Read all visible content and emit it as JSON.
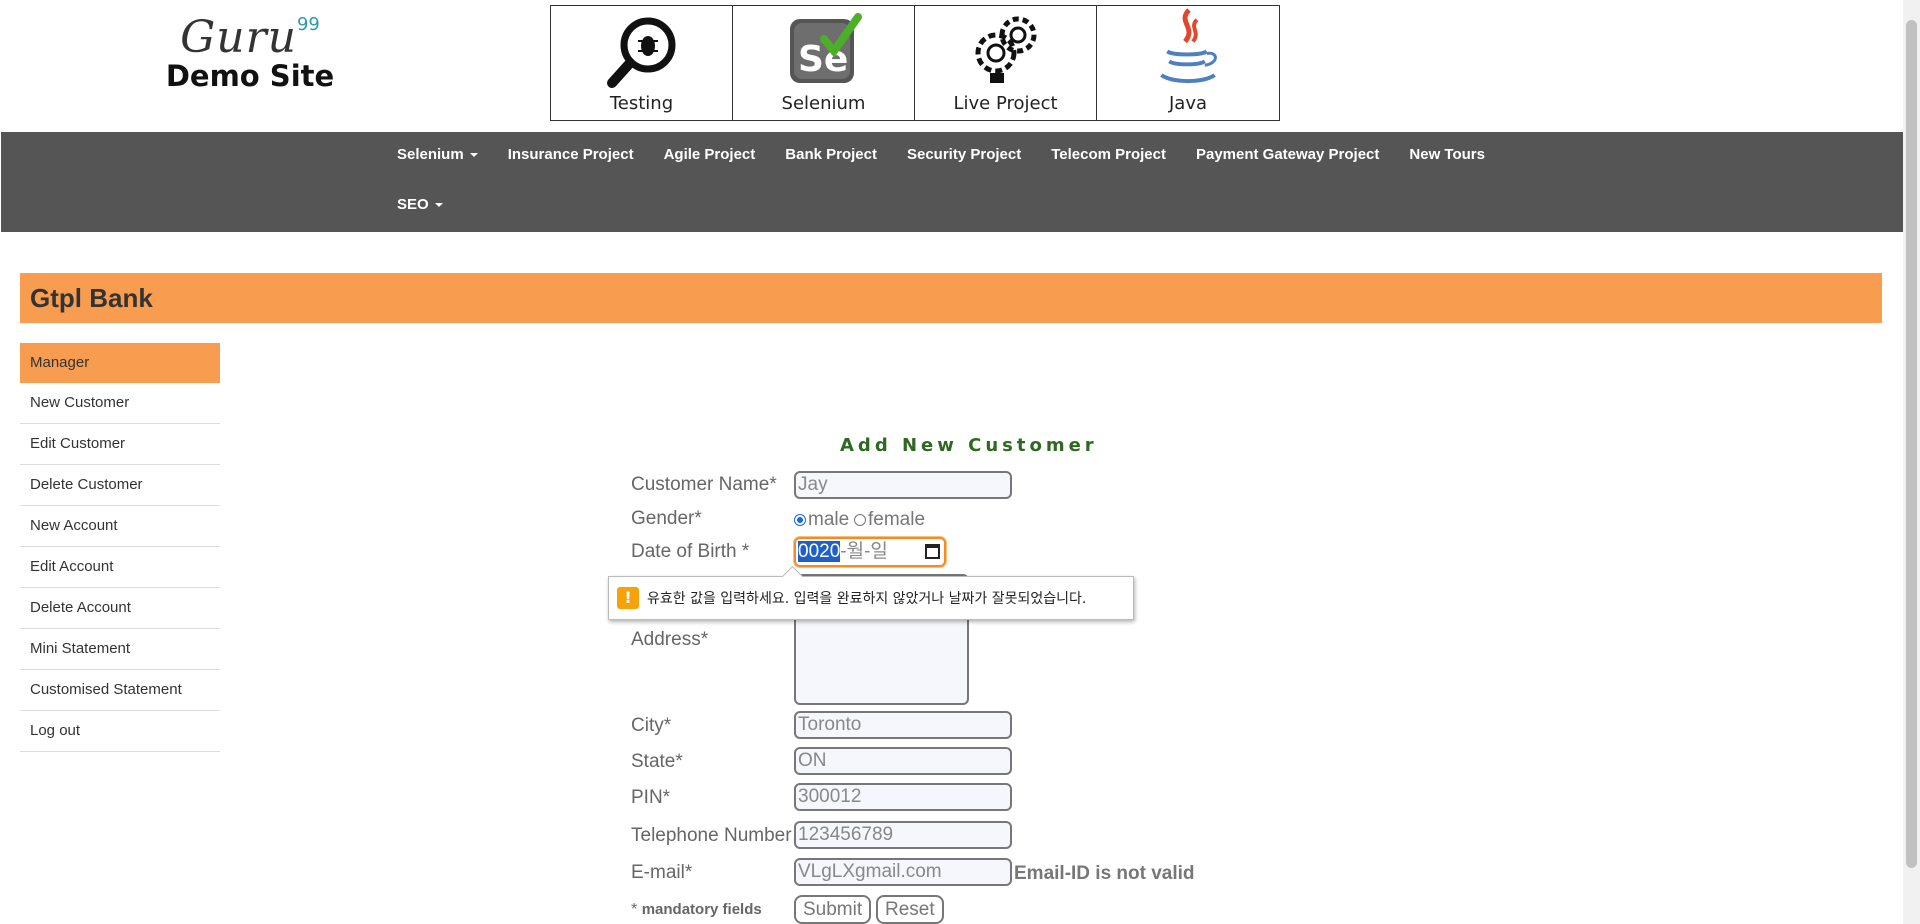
{
  "logo": {
    "brand": "Guru",
    "superscript": "99",
    "subtitle": "Demo Site"
  },
  "tiles": [
    {
      "label": "Testing",
      "icon": "bug-magnifier-icon"
    },
    {
      "label": "Selenium",
      "icon": "selenium-icon"
    },
    {
      "label": "Live Project",
      "icon": "gear-bulb-icon"
    },
    {
      "label": "Java",
      "icon": "java-cup-icon"
    }
  ],
  "nav": {
    "row1": [
      "Selenium",
      "Insurance Project",
      "Agile Project",
      "Bank Project",
      "Security Project",
      "Telecom Project",
      "Payment Gateway Project",
      "New Tours"
    ],
    "row2": [
      "SEO"
    ]
  },
  "bank_title": "Gtpl Bank",
  "sidebar": {
    "header": "Manager",
    "items": [
      "New Customer",
      "Edit Customer",
      "Delete Customer",
      "New Account",
      "Edit Account",
      "Delete Account",
      "Mini Statement",
      "Customised Statement",
      "Log out"
    ]
  },
  "form": {
    "title": "Add New Customer",
    "labels": {
      "name": "Customer Name*",
      "gender": "Gender*",
      "dob": "Date of Birth *",
      "address": "Address*",
      "city": "City*",
      "state": "State*",
      "pin": "PIN*",
      "phone": "Telephone Number",
      "email": "E-mail*"
    },
    "values": {
      "name": "Jay",
      "city": "Toronto",
      "state": "ON",
      "pin": "300012",
      "phone": "123456789",
      "email": "VLgLXgmail.com"
    },
    "gender_options": [
      "male",
      "female"
    ],
    "dob": {
      "year": "0020",
      "rest": "-월-일"
    },
    "tooltip": "유효한 값을 입력하세요. 입력을 완료하지 않았거나 날짜가 잘못되었습니다.",
    "email_error": "Email-ID is not valid",
    "mandatory_star": "*",
    "mandatory_text": "mandatory fields",
    "submit": "Submit",
    "reset": "Reset"
  },
  "colors": {
    "accent": "#f89c50",
    "nav_bg": "#555555",
    "title_green": "#2d6a1f"
  }
}
